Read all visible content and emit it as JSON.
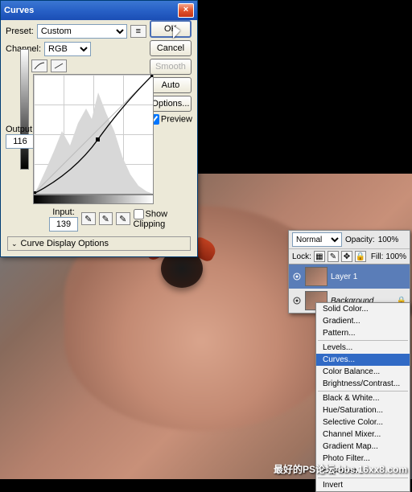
{
  "dialog": {
    "title": "Curves",
    "preset_label": "Preset:",
    "preset_value": "Custom",
    "channel_label": "Channel:",
    "channel_value": "RGB",
    "output_label": "Output:",
    "output_value": "116",
    "input_label": "Input:",
    "input_value": "139",
    "show_clipping": "Show Clipping",
    "curve_display_options": "Curve Display Options",
    "buttons": {
      "ok": "OK",
      "cancel": "Cancel",
      "smooth": "Smooth",
      "auto": "Auto",
      "options": "Options...",
      "preview": "Preview"
    }
  },
  "chart_data": {
    "type": "line",
    "title": "Curves",
    "xlabel": "Input",
    "ylabel": "Output",
    "xlim": [
      0,
      255
    ],
    "ylim": [
      0,
      255
    ],
    "series": [
      {
        "name": "curve",
        "x": [
          0,
          64,
          139,
          200,
          255
        ],
        "y": [
          0,
          42,
          116,
          195,
          255
        ]
      },
      {
        "name": "diagonal-reference",
        "x": [
          0,
          255
        ],
        "y": [
          0,
          255
        ]
      }
    ],
    "control_point": {
      "input": 139,
      "output": 116
    },
    "histogram_peaks_x": [
      30,
      65,
      95,
      115,
      130,
      150,
      175,
      200
    ]
  },
  "layers": {
    "blend_mode": "Normal",
    "opacity_label": "Opacity:",
    "opacity_value": "100%",
    "lock_label": "Lock:",
    "fill_label": "Fill:",
    "fill_value": "100%",
    "items": [
      {
        "name": "Layer 1",
        "active": true
      },
      {
        "name": "Background",
        "active": false
      }
    ]
  },
  "menu": {
    "items": [
      "Solid Color...",
      "Gradient...",
      "Pattern...",
      "",
      "Levels...",
      "Curves...",
      "Color Balance...",
      "Brightness/Contrast...",
      "",
      "Black & White...",
      "Hue/Saturation...",
      "Selective Color...",
      "Channel Mixer...",
      "Gradient Map...",
      "Photo Filter...",
      "Exposure...",
      "",
      "Invert"
    ],
    "selected": "Curves..."
  },
  "watermark": "最好的PS论坛-bbs.16xx8.com"
}
